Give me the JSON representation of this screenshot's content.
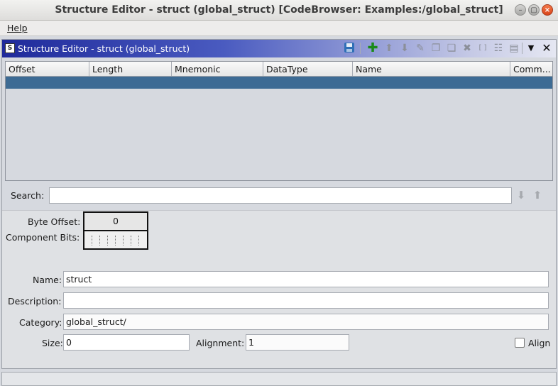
{
  "window": {
    "title": "Structure Editor - struct (global_struct) [CodeBrowser: Examples:/global_struct]",
    "buttons": [
      "minimize",
      "maximize",
      "close"
    ]
  },
  "menubar": {
    "items": [
      {
        "label": "Help"
      }
    ]
  },
  "panel": {
    "title": "Structure Editor - struct (global_struct)",
    "icon_letter": "S",
    "toolbar_icons": [
      "save-icon",
      "add-icon",
      "move-up-icon",
      "move-down-icon",
      "edit-icon",
      "duplicate-icon",
      "duplicate-multiple-icon",
      "delete-icon",
      "array-icon",
      "unpackage-icon",
      "show-component-icon",
      "menu-dropdown-icon",
      "close-icon"
    ]
  },
  "table": {
    "columns": [
      "Offset",
      "Length",
      "Mnemonic",
      "DataType",
      "Name",
      "Comm..."
    ]
  },
  "search": {
    "label": "Search:",
    "value": ""
  },
  "details": {
    "byte_offset_label": "Byte Offset:",
    "byte_offset_value": "0",
    "component_bits_label": "Component Bits:",
    "name_label": "Name:",
    "name_value": "struct",
    "description_label": "Description:",
    "description_value": "",
    "category_label": "Category:",
    "category_value": "global_struct/",
    "size_label": "Size:",
    "size_value": "0",
    "alignment_label": "Alignment:",
    "alignment_value": "1",
    "align_checkbox_label": "Align",
    "align_checked": false
  },
  "colors": {
    "title_gradient_start": "#1f2a9b",
    "selected_row": "#3d6b94",
    "close_button": "#e05a2a",
    "add_icon": "#1a8a1a"
  }
}
